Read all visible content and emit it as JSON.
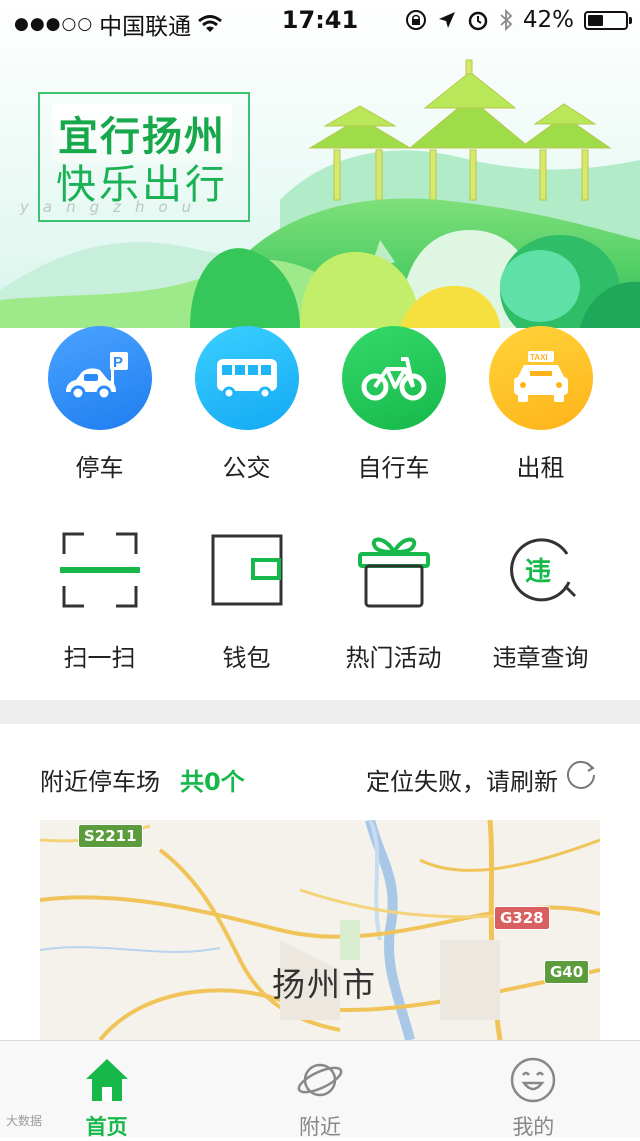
{
  "status_bar": {
    "signal": "●●●○○",
    "carrier": "中国联通",
    "time": "17:41",
    "battery": "42%",
    "battery_level": 0.42
  },
  "banner": {
    "slogan_line1": "宜行扬州",
    "slogan_line2": "快乐出行",
    "slogan_line3": "yangzhou"
  },
  "services": [
    {
      "label": "停车",
      "icon": "car-parking-icon",
      "color": "#2a8cf8"
    },
    {
      "label": "公交",
      "icon": "bus-icon",
      "color": "#1fb6f8"
    },
    {
      "label": "自行车",
      "icon": "bicycle-icon",
      "color": "#1fc458"
    },
    {
      "label": "出租",
      "icon": "taxi-icon",
      "color": "#ffc125"
    }
  ],
  "taxi_sign": "TAXI",
  "tools": [
    {
      "label": "扫一扫",
      "icon": "scan-icon"
    },
    {
      "label": "钱包",
      "icon": "wallet-icon"
    },
    {
      "label": "热门活动",
      "icon": "gift-icon"
    },
    {
      "label": "违章查询",
      "icon": "violation-search-icon",
      "badge": "违"
    }
  ],
  "nearby": {
    "title": "附近停车场",
    "count": "共0个",
    "status": "定位失败，请刷新"
  },
  "map": {
    "city": "扬州市",
    "roads": [
      "S2211",
      "G328",
      "G40"
    ]
  },
  "tabs": [
    {
      "label": "首页",
      "icon": "home-icon",
      "active": true
    },
    {
      "label": "附近",
      "icon": "planet-icon",
      "active": false
    },
    {
      "label": "我的",
      "icon": "smiley-icon",
      "active": false
    }
  ],
  "watermark": "大数据",
  "colors": {
    "accent": "#16b84a"
  }
}
